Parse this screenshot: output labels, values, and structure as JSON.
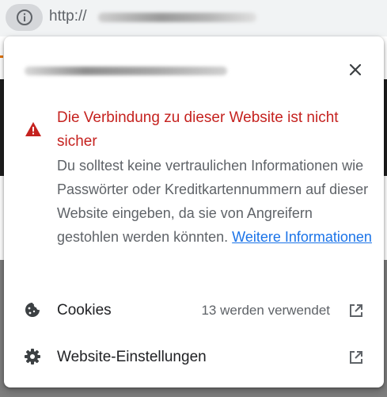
{
  "address_bar": {
    "url_prefix": "http://",
    "info_icon": "info-icon"
  },
  "popup": {
    "close_icon": "close-icon",
    "warning": {
      "icon": "warning-icon",
      "title": "Die Verbindung zu dieser Website ist nicht sicher",
      "body": "Du solltest keine vertraulichen Informationen wie Passwörter oder Kreditkartennummern auf dieser Website eingeben, da sie von Angreifern gestohlen werden könnten. ",
      "more_link": "Weitere Informationen"
    },
    "rows": [
      {
        "icon": "cookie-icon",
        "label": "Cookies",
        "value": "13 werden verwendet",
        "action_icon": "external-link-icon"
      },
      {
        "icon": "gear-icon",
        "label": "Website-Einstellungen",
        "value": "",
        "action_icon": "external-link-icon"
      }
    ]
  },
  "colors": {
    "warning_red": "#c5221f",
    "link_blue": "#1a73e8",
    "text_gray": "#5f6368"
  }
}
